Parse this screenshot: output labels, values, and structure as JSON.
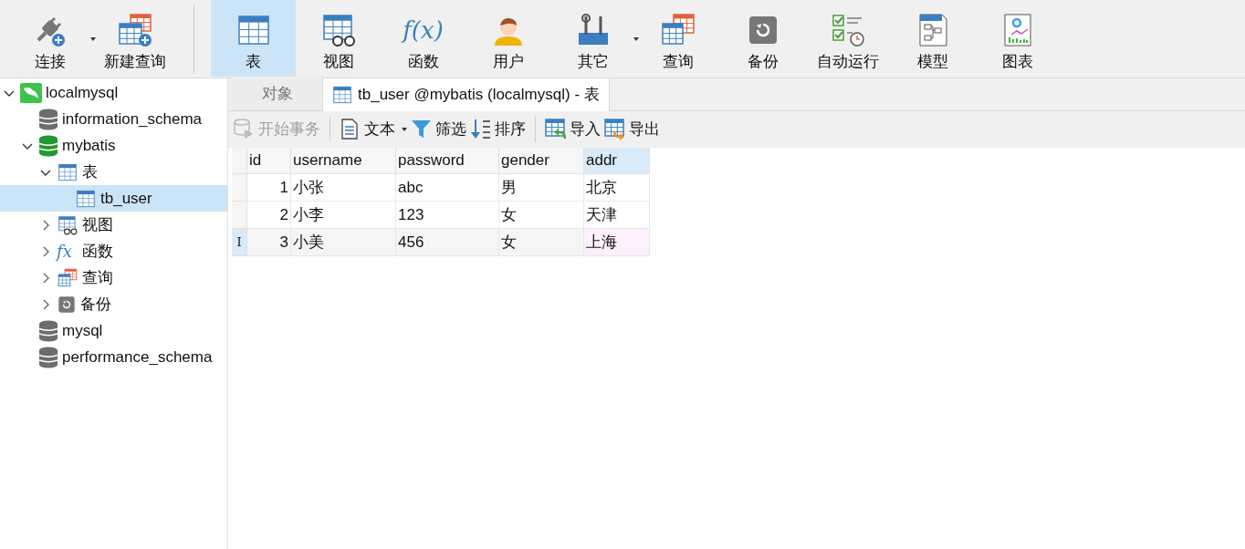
{
  "toolbar": {
    "groups": [
      [
        {
          "kind": "connect",
          "label": "连接",
          "selected": false,
          "dropdown": true
        },
        {
          "kind": "newquery",
          "label": "新建查询",
          "selected": false,
          "dropdown": false
        }
      ],
      [
        {
          "kind": "table",
          "label": "表",
          "selected": true,
          "dropdown": false
        },
        {
          "kind": "view",
          "label": "视图",
          "selected": false,
          "dropdown": false
        },
        {
          "kind": "function",
          "glyph": "f(x)",
          "label": "函数",
          "selected": false,
          "dropdown": false
        },
        {
          "kind": "user",
          "label": "用户",
          "selected": false,
          "dropdown": false
        },
        {
          "kind": "other",
          "label": "其它",
          "selected": false,
          "dropdown": true
        },
        {
          "kind": "query",
          "label": "查询",
          "selected": false,
          "dropdown": false
        },
        {
          "kind": "backup",
          "label": "备份",
          "selected": false,
          "dropdown": false
        },
        {
          "kind": "schedule",
          "label": "自动运行",
          "selected": false,
          "dropdown": false
        },
        {
          "kind": "model",
          "label": "模型",
          "selected": false,
          "dropdown": false
        },
        {
          "kind": "chart",
          "label": "图表",
          "selected": false,
          "dropdown": false
        }
      ]
    ]
  },
  "sidebar": {
    "items": [
      {
        "kind": "connection",
        "label": "localmysql",
        "expanded": true,
        "selected": false,
        "children": [
          {
            "kind": "database",
            "label": "information_schema",
            "selected": false
          },
          {
            "kind": "database",
            "label": "mybatis",
            "expanded": true,
            "selected": false,
            "children": [
              {
                "kind": "table",
                "label": "表",
                "expanded": true,
                "selected": false,
                "children": [
                  {
                    "kind": "table",
                    "label": "tb_user",
                    "selected": true
                  }
                ]
              },
              {
                "kind": "view",
                "label": "视图",
                "expanded": false,
                "selected": false
              },
              {
                "kind": "function",
                "glyph": "fx",
                "label": "函数",
                "expanded": false,
                "selected": false
              },
              {
                "kind": "query",
                "label": "查询",
                "expanded": false,
                "selected": false
              },
              {
                "kind": "backup",
                "label": "备份",
                "expanded": false,
                "selected": false
              }
            ]
          },
          {
            "kind": "database",
            "label": "mysql",
            "selected": false
          },
          {
            "kind": "database",
            "label": "performance_schema",
            "selected": false
          }
        ]
      }
    ]
  },
  "tabs": [
    {
      "label": "对象",
      "selected": false,
      "icon": false
    },
    {
      "label": "tb_user @mybatis (localmysql) - 表",
      "selected": true,
      "icon": true
    }
  ],
  "action_groups": [
    [
      {
        "kind": "transaction",
        "label": "开始事务",
        "disabled": true,
        "dropdown": false
      }
    ],
    [
      {
        "kind": "text",
        "label": "文本",
        "disabled": false,
        "dropdown": true
      },
      {
        "kind": "filter",
        "label": "筛选",
        "disabled": false,
        "dropdown": false
      },
      {
        "kind": "sort",
        "label": "排序",
        "disabled": false,
        "dropdown": false
      }
    ],
    [
      {
        "kind": "import",
        "label": "导入",
        "disabled": false,
        "dropdown": false
      },
      {
        "kind": "export",
        "label": "导出",
        "disabled": false,
        "dropdown": false
      }
    ]
  ],
  "table": {
    "columns": [
      {
        "kind": "number",
        "label": "id",
        "selected": false
      },
      {
        "kind": "text",
        "label": "username",
        "selected": false
      },
      {
        "kind": "text",
        "label": "password",
        "selected": false
      },
      {
        "kind": "text",
        "label": "gender",
        "selected": false
      },
      {
        "kind": "text",
        "label": "addr",
        "selected": true
      }
    ],
    "rows": [
      {
        "selected": false,
        "cells": [
          "1",
          "小张",
          "abc",
          "男",
          "北京"
        ]
      },
      {
        "selected": false,
        "cells": [
          "2",
          "小李",
          "123",
          "女",
          "天津"
        ]
      },
      {
        "selected": true,
        "marker": "I",
        "cells": [
          "3",
          "小美",
          "456",
          "女",
          "上海"
        ]
      }
    ]
  }
}
